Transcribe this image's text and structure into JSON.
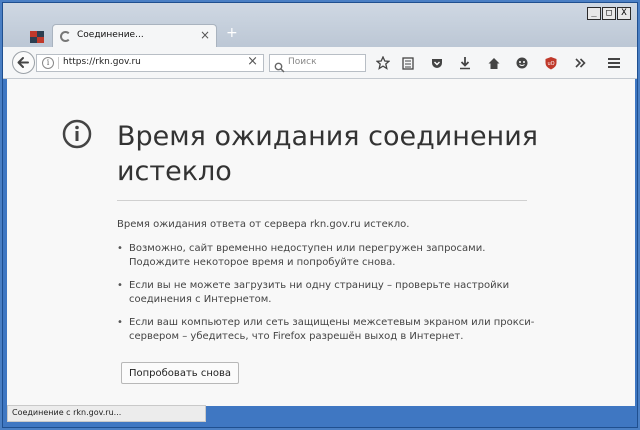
{
  "window": {
    "controls": {
      "minimize": "_",
      "maximize": "□",
      "close": "X"
    }
  },
  "tab": {
    "title": "Соединение...",
    "close": "×",
    "new_tab": "+"
  },
  "navbar": {
    "url": "https://rkn.gov.ru",
    "stop": "×",
    "search_placeholder": "Поиск"
  },
  "content": {
    "title": "Время ожидания соединения истекло",
    "description": "Время ожидания ответа от сервера rkn.gov.ru истекло.",
    "bullets": [
      "Возможно, сайт временно недоступен или перегружен запросами. Подождите некоторое время и попробуйте снова.",
      "Если вы не можете загрузить ни одну страницу – проверьте настройки соединения с Интернетом.",
      "Если ваш компьютер или сеть защищены межсетевым экраном или прокси-сервером – убедитесь, что Firefox разрешён выход в Интернет."
    ],
    "retry_button": "Попробовать снова"
  },
  "status": {
    "text": "Соединение с rkn.gov.ru..."
  },
  "colors": {
    "window_frame": "#3f77c2",
    "content_bg": "#f8f8f8",
    "text": "#333333",
    "ublock_red": "#c0392b"
  }
}
